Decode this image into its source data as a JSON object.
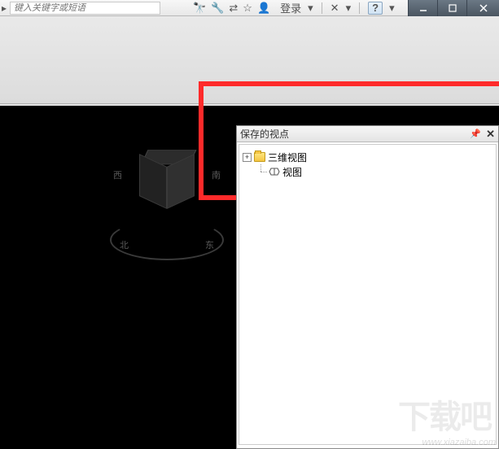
{
  "topbar": {
    "search_placeholder": "键入关键字或短语",
    "login_label": "登录",
    "help_label": "?"
  },
  "window_controls": {
    "minimize": "minimize",
    "maximize": "maximize",
    "close": "close"
  },
  "panel": {
    "title": "保存的视点",
    "tree": {
      "root": {
        "label": "三维视图",
        "expanded": false
      },
      "child": {
        "label": "视图"
      }
    }
  },
  "viewcube": {
    "faces": {
      "top": "",
      "front": "",
      "side": ""
    },
    "compass": {
      "n": "北",
      "e": "东",
      "s": "西",
      "w": "南"
    }
  },
  "watermark": {
    "logo": "下载吧",
    "url": "www.xiazaiba.com"
  }
}
